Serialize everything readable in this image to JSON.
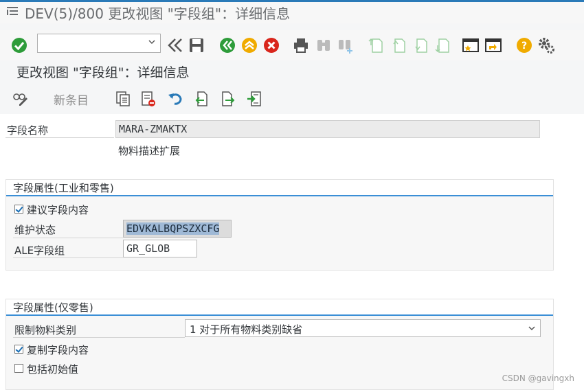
{
  "window": {
    "title": "DEV(5)/800 更改视图 \"字段组\"：详细信息"
  },
  "toolbar": {
    "command_field_value": "",
    "icons": [
      "enter-check-icon",
      "back-double-icon",
      "save-icon",
      "back-icon",
      "exit-icon",
      "cancel-icon",
      "print-icon",
      "find-icon",
      "find-next-icon",
      "first-page-icon",
      "previous-page-icon",
      "next-page-icon",
      "last-page-icon",
      "create-session-icon",
      "shortcut-icon",
      "help-icon",
      "customize-icon"
    ]
  },
  "screen": {
    "subtitle": "更改视图 \"字段组\"：详细信息"
  },
  "app_toolbar": {
    "new_entries": "新条目"
  },
  "header_fields": {
    "field_name_label": "字段名称",
    "field_name_value": "MARA-ZMAKTX",
    "field_desc": "物料描述扩展"
  },
  "group_industry": {
    "title": "字段属性(工业和零售)",
    "propose_label": "建议字段内容",
    "propose_checked": true,
    "maint_status_label": "维护状态",
    "maint_status_value": "EDVKALBQPSZXCFG",
    "ale_label": "ALE字段组",
    "ale_value": "GR_GLOB"
  },
  "group_retail": {
    "title": "字段属性(仅零售)",
    "restrict_label": "限制物料类别",
    "restrict_value": "1 对于所有物料类别缺省",
    "copy_label": "复制字段内容",
    "copy_checked": true,
    "init_label": "包括初始值",
    "init_checked": false
  },
  "watermark": "CSDN @gavingxh"
}
